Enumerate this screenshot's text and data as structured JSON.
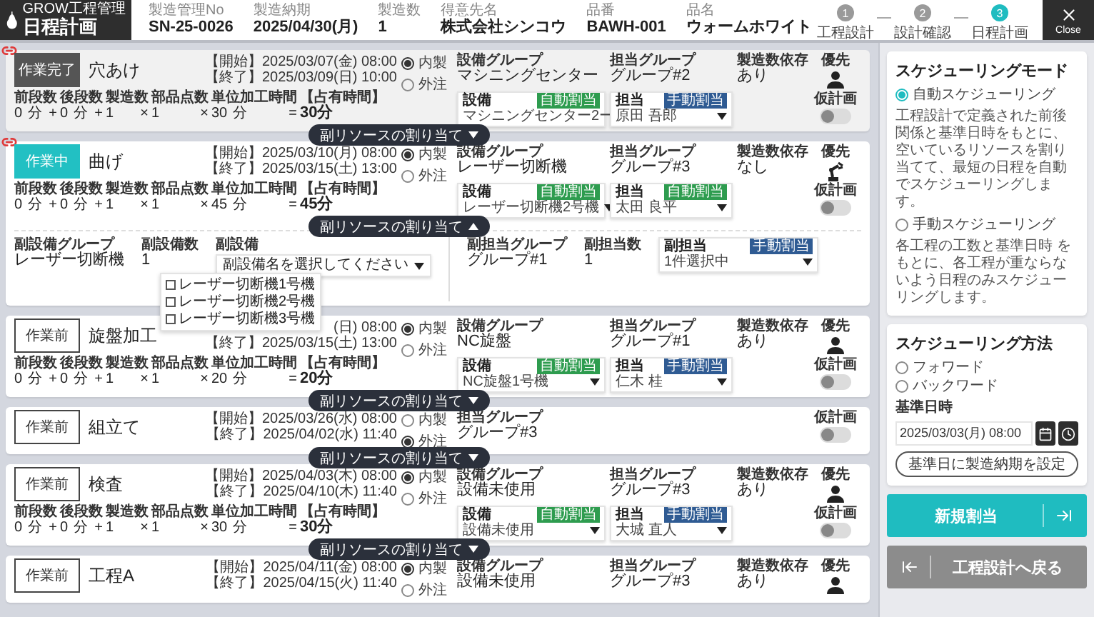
{
  "app": {
    "brand": "GROW工程管理",
    "title": "日程計画"
  },
  "order_info": [
    {
      "label": "製造管理No",
      "value": "SN-25-0026"
    },
    {
      "label": "製造納期",
      "value": "2025/04/30(月)"
    },
    {
      "label": "製造数",
      "value": "1"
    },
    {
      "label": "得意先名",
      "value": "株式会社シンコウ"
    },
    {
      "label": "品番",
      "value": "BAWH-001"
    },
    {
      "label": "品名",
      "value": "ウォームホワイト"
    }
  ],
  "steps": [
    {
      "number": "1",
      "label": "工程設計",
      "selected": false
    },
    {
      "number": "2",
      "label": "設計確認",
      "selected": false
    },
    {
      "number": "3",
      "label": "日程計画",
      "selected": true
    }
  ],
  "close": {
    "label": "Close"
  },
  "processes": [
    {
      "kind": "done",
      "status_label": "作業完了",
      "linked": true,
      "name": "穴あけ",
      "start": "【開始】2025/03/07(金) 08:00",
      "end": "【終了】2025/03/09(日) 10:00",
      "sourcing": [
        {
          "label": "内製",
          "selected": true
        },
        {
          "label": "外注",
          "selected": false
        }
      ],
      "durations": [
        {
          "label": "前段数",
          "value": "0",
          "unit": "分",
          "op": "+"
        },
        {
          "label": "後段数",
          "value": "0",
          "unit": "分",
          "op": "+"
        },
        {
          "label": "製造数",
          "value": "1",
          "op": "×"
        },
        {
          "label": "部品点数",
          "value": "1",
          "op": "×"
        },
        {
          "label": "単位加工時間",
          "value": "30",
          "unit": "分",
          "op": "="
        },
        {
          "label": "【占有時間】",
          "value": "30分"
        }
      ],
      "equipment_group": {
        "label": "設備グループ",
        "value": "マシニングセンター"
      },
      "staff_group": {
        "label": "担当グループ",
        "value": "グループ#2"
      },
      "dependency": {
        "label": "製造数依存",
        "value": "あり"
      },
      "equipment": {
        "label": "設備",
        "badge": "自動割当",
        "kind": "auto",
        "value": "マシニングセンター2ー"
      },
      "staff": {
        "label": "担当",
        "badge": "手動割当",
        "kind": "manual",
        "value": "原田 吾郎"
      },
      "priority": {
        "label": "優先",
        "kind": "person"
      },
      "provisional": {
        "label": "仮計画",
        "on": false
      },
      "sub_resources": {
        "label": "副リソースの割り当て",
        "expanded": false
      }
    },
    {
      "kind": "in_progress",
      "status_label": "作業中",
      "linked": true,
      "name": "曲げ",
      "start": "【開始】2025/03/10(月) 08:00",
      "end": "【終了】2025/03/15(土) 13:00",
      "sourcing": [
        {
          "label": "内製",
          "selected": true
        },
        {
          "label": "外注",
          "selected": false
        }
      ],
      "durations": [
        {
          "label": "前段数",
          "value": "0",
          "unit": "分",
          "op": "+"
        },
        {
          "label": "後段数",
          "value": "0",
          "unit": "分",
          "op": "+"
        },
        {
          "label": "製造数",
          "value": "1",
          "op": "×"
        },
        {
          "label": "部品点数",
          "value": "1",
          "op": "×"
        },
        {
          "label": "単位加工時間",
          "value": "45",
          "unit": "分",
          "op": "="
        },
        {
          "label": "【占有時間】",
          "value": "45分"
        }
      ],
      "equipment_group": {
        "label": "設備グループ",
        "value": "レーザー切断機"
      },
      "staff_group": {
        "label": "担当グループ",
        "value": "グループ#3"
      },
      "dependency": {
        "label": "製造数依存",
        "value": "なし"
      },
      "equipment": {
        "label": "設備",
        "badge": "自動割当",
        "kind": "auto",
        "value": "レーザー切断機2号機"
      },
      "staff": {
        "label": "担当",
        "badge": "自動割当",
        "kind": "auto",
        "value": "太田 良平"
      },
      "priority": {
        "label": "優先",
        "kind": "robot"
      },
      "provisional": {
        "label": "仮計画",
        "on": false
      },
      "sub_resources": {
        "label": "副リソースの割り当て",
        "expanded": true
      },
      "sub_panel": {
        "equipment_group": {
          "label": "副設備グループ",
          "value": "レーザー切断機"
        },
        "equipment_count": {
          "label": "副設備数",
          "value": "1"
        },
        "equipment": {
          "label": "副設備",
          "placeholder": "副設備名を選択してください",
          "open": true,
          "options": [
            {
              "label": "レーザー切断機1号機",
              "checked": false
            },
            {
              "label": "レーザー切断機2号機",
              "checked": false
            },
            {
              "label": "レーザー切断機3号機",
              "checked": false
            }
          ]
        },
        "staff_group": {
          "label": "副担当グループ",
          "value": "グループ#1"
        },
        "staff_count": {
          "label": "副担当数",
          "value": "1"
        },
        "staff": {
          "label": "副担当",
          "badge": "手動割当",
          "kind": "manual",
          "value": "1件選択中"
        }
      }
    },
    {
      "kind": "not_started",
      "status_label": "作業前",
      "linked": false,
      "name": "旋盤加工",
      "start": "(日) 08:00",
      "end": "【終了】2025/03/15(土) 13:00",
      "sourcing": [
        {
          "label": "内製",
          "selected": true
        },
        {
          "label": "外注",
          "selected": false
        }
      ],
      "durations": [
        {
          "label": "前段数",
          "value": "0",
          "unit": "分",
          "op": "+"
        },
        {
          "label": "後段数",
          "value": "0",
          "unit": "分",
          "op": "+"
        },
        {
          "label": "製造数",
          "value": "1",
          "op": "×"
        },
        {
          "label": "部品点数",
          "value": "1",
          "op": "×"
        },
        {
          "label": "単位加工時間",
          "value": "20",
          "unit": "分",
          "op": "="
        },
        {
          "label": "【占有時間】",
          "value": "20分"
        }
      ],
      "equipment_group": {
        "label": "設備グループ",
        "value": "NC旋盤"
      },
      "staff_group": {
        "label": "担当グループ",
        "value": "グループ#1"
      },
      "dependency": {
        "label": "製造数依存",
        "value": "あり"
      },
      "equipment": {
        "label": "設備",
        "badge": "自動割当",
        "kind": "auto",
        "value": "NC旋盤1号機"
      },
      "staff": {
        "label": "担当",
        "badge": "手動割当",
        "kind": "manual",
        "value": "仁木 桂"
      },
      "priority": {
        "label": "優先",
        "kind": "person"
      },
      "provisional": {
        "label": "仮計画",
        "on": false
      },
      "sub_resources": {
        "label": "副リソースの割り当て",
        "expanded": false
      }
    },
    {
      "kind": "not_started",
      "status_label": "作業前",
      "linked": false,
      "name": "組立て",
      "start": "【開始】2025/03/26(水) 08:00",
      "end": "【終了】2025/04/02(水) 11:40",
      "sourcing": [
        {
          "label": "内製",
          "selected": false
        },
        {
          "label": "外注",
          "selected": true
        }
      ],
      "staff_group": {
        "label": "担当グループ",
        "value": "グループ#3"
      },
      "provisional": {
        "label": "仮計画",
        "on": false
      },
      "sub_resources": {
        "label": "副リソースの割り当て",
        "expanded": false
      }
    },
    {
      "kind": "not_started",
      "status_label": "作業前",
      "linked": false,
      "name": "検査",
      "start": "【開始】2025/04/03(木) 08:00",
      "end": "【終了】2025/04/10(木) 11:40",
      "sourcing": [
        {
          "label": "内製",
          "selected": true
        },
        {
          "label": "外注",
          "selected": false
        }
      ],
      "durations": [
        {
          "label": "前段数",
          "value": "0",
          "unit": "分",
          "op": "+"
        },
        {
          "label": "後段数",
          "value": "0",
          "unit": "分",
          "op": "+"
        },
        {
          "label": "製造数",
          "value": "1",
          "op": "×"
        },
        {
          "label": "部品点数",
          "value": "1",
          "op": "×"
        },
        {
          "label": "単位加工時間",
          "value": "30",
          "unit": "分",
          "op": "="
        },
        {
          "label": "【占有時間】",
          "value": "30分"
        }
      ],
      "equipment_group": {
        "label": "設備グループ",
        "value": "設備未使用"
      },
      "staff_group": {
        "label": "担当グループ",
        "value": "グループ#3"
      },
      "dependency": {
        "label": "製造数依存",
        "value": "あり"
      },
      "equipment": {
        "label": "設備",
        "badge": "自動割当",
        "kind": "auto",
        "value": "設備未使用"
      },
      "staff": {
        "label": "担当",
        "badge": "手動割当",
        "kind": "manual",
        "value": "大城 直人"
      },
      "priority": {
        "label": "優先",
        "kind": "person"
      },
      "provisional": {
        "label": "仮計画",
        "on": false
      },
      "sub_resources": {
        "label": "副リソースの割り当て",
        "expanded": false
      }
    },
    {
      "kind": "not_started",
      "status_label": "作業前",
      "linked": false,
      "name": "工程A",
      "start": "【開始】2025/04/11(金) 08:00",
      "end": "【終了】2025/04/15(火) 11:40",
      "sourcing": [
        {
          "label": "内製",
          "selected": true
        },
        {
          "label": "外注",
          "selected": false
        }
      ],
      "equipment_group": {
        "label": "設備グループ",
        "value": "設備未使用"
      },
      "staff_group": {
        "label": "担当グループ",
        "value": "グループ#3"
      },
      "dependency": {
        "label": "製造数依存",
        "value": "あり"
      },
      "priority": {
        "label": "優先",
        "kind": "person"
      }
    }
  ],
  "scheduling_mode": {
    "title": "スケジューリングモード",
    "options": [
      {
        "label": "自動スケジューリング",
        "selected": true,
        "description": "工程設計で定義された前後関係と基準日時をもとに、空いているリソースを割り当てて、最短の日程を自動でスケジューリングします。"
      },
      {
        "label": "手動スケジューリング",
        "selected": false,
        "description": "各工程の工数と基準日時 をもとに、各工程が重ならないよう日程のみスケジューリングします。"
      }
    ]
  },
  "scheduling_method": {
    "title": "スケジューリング方法",
    "directions": [
      {
        "label": "フォワード",
        "selected": false
      },
      {
        "label": "バックワード",
        "selected": false
      }
    ],
    "base_label": "基準日時",
    "base_value": "2025/03/03(月) 08:00",
    "set_button": "基準日に製造納期を設定"
  },
  "actions": [
    {
      "kind": "primary",
      "label": "新規割当"
    },
    {
      "kind": "back",
      "label": "工程設計へ戻る"
    }
  ]
}
